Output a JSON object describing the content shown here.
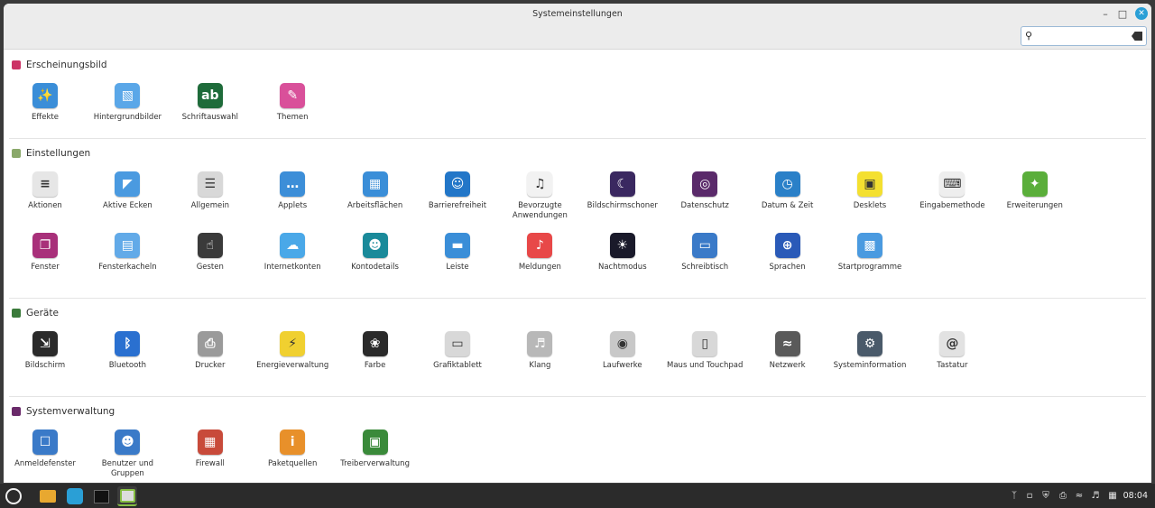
{
  "window": {
    "title": "Systemeinstellungen"
  },
  "search": {
    "value": "",
    "placeholder": ""
  },
  "sections": [
    {
      "label": "Erscheinungsbild",
      "color": "#cc3366",
      "items": [
        {
          "label": "Effekte",
          "icon": "effects-icon",
          "color": "#3a8ed8"
        },
        {
          "label": "Hintergrundbilder",
          "icon": "wallpaper-icon",
          "color": "#5aa7e8"
        },
        {
          "label": "Schriftauswahl",
          "icon": "font-icon",
          "color": "#1e6b3a"
        },
        {
          "label": "Themen",
          "icon": "themes-icon",
          "color": "#d9509a"
        }
      ]
    },
    {
      "label": "Einstellungen",
      "color": "#8aa86a",
      "items": [
        {
          "label": "Aktionen",
          "icon": "actions-icon",
          "color": "#e6e6e6"
        },
        {
          "label": "Aktive Ecken",
          "icon": "hot-corners-icon",
          "color": "#4a9ae0"
        },
        {
          "label": "Allgemein",
          "icon": "general-icon",
          "color": "#d8d8d8"
        },
        {
          "label": "Applets",
          "icon": "applets-icon",
          "color": "#3c8ed8"
        },
        {
          "label": "Arbeitsflächen",
          "icon": "workspaces-icon",
          "color": "#3a8ed8"
        },
        {
          "label": "Barrierefreiheit",
          "icon": "accessibility-icon",
          "color": "#2276c8"
        },
        {
          "label": "Bevorzugte Anwendungen",
          "icon": "preferred-apps-icon",
          "color": "#f2f2f2"
        },
        {
          "label": "Bildschirmschoner",
          "icon": "screensaver-icon",
          "color": "#3a2860"
        },
        {
          "label": "Datenschutz",
          "icon": "privacy-icon",
          "color": "#5a2a6a"
        },
        {
          "label": "Datum & Zeit",
          "icon": "clock-icon",
          "color": "#2a80c8"
        },
        {
          "label": "Desklets",
          "icon": "desklets-icon",
          "color": "#f4e030"
        },
        {
          "label": "Eingabemethode",
          "icon": "input-method-icon",
          "color": "#eeeeee"
        },
        {
          "label": "Erweiterungen",
          "icon": "extensions-icon",
          "color": "#5aae3a"
        },
        {
          "label": "Fenster",
          "icon": "windows-icon",
          "color": "#a8307a"
        },
        {
          "label": "Fensterkacheln",
          "icon": "window-tiling-icon",
          "color": "#62aae8"
        },
        {
          "label": "Gesten",
          "icon": "gestures-icon",
          "color": "#3a3a3a"
        },
        {
          "label": "Internetkonten",
          "icon": "online-accounts-icon",
          "color": "#4aa8e8"
        },
        {
          "label": "Kontodetails",
          "icon": "account-icon",
          "color": "#1a8a9a"
        },
        {
          "label": "Leiste",
          "icon": "panel-icon",
          "color": "#3a8ed8"
        },
        {
          "label": "Meldungen",
          "icon": "notifications-icon",
          "color": "#e84848"
        },
        {
          "label": "Nachtmodus",
          "icon": "night-mode-icon",
          "color": "#1a1a2a"
        },
        {
          "label": "Schreibtisch",
          "icon": "desktop-icon",
          "color": "#3a7ac8"
        },
        {
          "label": "Sprachen",
          "icon": "languages-icon",
          "color": "#2a5ab8"
        },
        {
          "label": "Startprogramme",
          "icon": "startup-icon",
          "color": "#4a9ae0"
        }
      ]
    },
    {
      "label": "Geräte",
      "color": "#3a7a3a",
      "items": [
        {
          "label": "Bildschirm",
          "icon": "display-icon",
          "color": "#2a2a2a"
        },
        {
          "label": "Bluetooth",
          "icon": "bluetooth-icon",
          "color": "#2a70d0"
        },
        {
          "label": "Drucker",
          "icon": "printer-icon",
          "color": "#9a9a9a"
        },
        {
          "label": "Energieverwaltung",
          "icon": "power-icon",
          "color": "#f0d030"
        },
        {
          "label": "Farbe",
          "icon": "color-icon",
          "color": "#2a2a2a"
        },
        {
          "label": "Grafiktablett",
          "icon": "tablet-icon",
          "color": "#d8d8d8"
        },
        {
          "label": "Klang",
          "icon": "sound-icon",
          "color": "#b8b8b8"
        },
        {
          "label": "Laufwerke",
          "icon": "disks-icon",
          "color": "#c8c8c8"
        },
        {
          "label": "Maus und Touchpad",
          "icon": "mouse-icon",
          "color": "#d8d8d8"
        },
        {
          "label": "Netzwerk",
          "icon": "network-icon",
          "color": "#5a5a5a"
        },
        {
          "label": "Systeminformation",
          "icon": "system-info-icon",
          "color": "#4a5a6a"
        },
        {
          "label": "Tastatur",
          "icon": "keyboard-icon",
          "color": "#e2e2e2"
        }
      ]
    },
    {
      "label": "Systemverwaltung",
      "color": "#6a2a6a",
      "items": [
        {
          "label": "Anmeldefenster",
          "icon": "login-window-icon",
          "color": "#3a7ac8"
        },
        {
          "label": "Benutzer und Gruppen",
          "icon": "users-icon",
          "color": "#3a7ac8"
        },
        {
          "label": "Firewall",
          "icon": "firewall-icon",
          "color": "#c84a3a"
        },
        {
          "label": "Paketquellen",
          "icon": "software-sources-icon",
          "color": "#e8902a"
        },
        {
          "label": "Treiberverwaltung",
          "icon": "driver-manager-icon",
          "color": "#3a8a3a"
        }
      ]
    }
  ],
  "taskbar": {
    "clock": "08:04"
  }
}
